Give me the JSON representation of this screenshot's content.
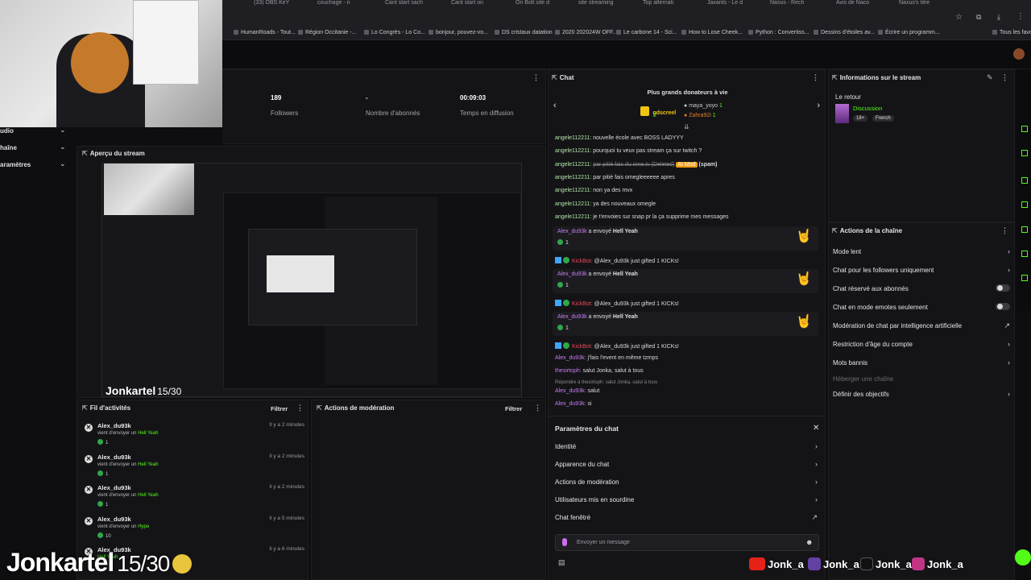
{
  "browser": {
    "tabs": [
      "(33) OBS KeY",
      "couchage - n",
      "Cant start sach",
      "Cant start on",
      "On Bolt site d",
      "site streaming",
      "Top alternati",
      "Jaxants - Le d",
      "Nasus - Rech",
      "Avis de Naco",
      "Naxus's titre"
    ],
    "bookmarks": [
      "HumanRoads - Tout...",
      "Région Occitanie -...",
      "Lo Congrès - Lo Co...",
      "bonjour, pouvez-vo...",
      "DS cristaux datation",
      "2020 202024W OFF...",
      "Le carbone 14 - Sci...",
      "How to Lose Cheek...",
      "Python : Convertiss...",
      "Dessins d'étoiles av...",
      "Écrire un programm...",
      "Tous les favoris"
    ]
  },
  "left_menu": {
    "items": [
      "udio",
      "haîne",
      "aramètres"
    ]
  },
  "stats": [
    {
      "value": "189",
      "label": "Followers"
    },
    {
      "value": "-",
      "label": "Nombre d'abonnés"
    },
    {
      "value": "00:09:03",
      "label": "Temps en diffusion"
    }
  ],
  "preview": {
    "title": "Aperçu du stream",
    "overlay_name": "Jonkartel",
    "overlay_count": "15/30"
  },
  "activity": {
    "title": "Fil d'activités",
    "filter_label": "Filtrer",
    "items": [
      {
        "name": "Alex_du93k",
        "action": "vient d'envoyer un",
        "gift": "Hell Yeah",
        "time": "Il y a 2 minutes",
        "count": "1"
      },
      {
        "name": "Alex_du93k",
        "action": "vient d'envoyer un",
        "gift": "Hell Yeah",
        "time": "Il y a 2 minutes",
        "count": "1"
      },
      {
        "name": "Alex_du93k",
        "action": "vient d'envoyer un",
        "gift": "Hell Yeah",
        "time": "Il y a 2 minutes",
        "count": "1"
      },
      {
        "name": "Alex_du93k",
        "action": "vient d'envoyer un",
        "gift": "Hype",
        "time": "Il y a 5 minutes",
        "count": "10"
      },
      {
        "name": "Alex_du93k",
        "action": "",
        "gift": "Hell Yeah",
        "time": "Il y a 6 minutes",
        "count": ""
      }
    ]
  },
  "moderation": {
    "title": "Actions de modération",
    "filter_label": "Filtrer"
  },
  "chat": {
    "title": "Chat",
    "donors_title": "Plus grands donateurs à vie",
    "donors": [
      {
        "name": "gdscreel",
        "amount": "2"
      },
      {
        "name": "maya_yoyo",
        "amount": "1"
      },
      {
        "name": "Zahra92i",
        "amount": "1"
      }
    ],
    "messages": [
      {
        "user": "angele112211:",
        "text": "nouvelle école avec BOSS LADYYY"
      },
      {
        "user": "angele112211:",
        "text": "pourquoi tu veux pas stream ça sur twitch ?"
      },
      {
        "user": "angele112211:",
        "text": "par pitié fais du ome.tv (Deleted)",
        "tag": "AI Mod",
        "suffix": "(spam)"
      },
      {
        "user": "angele112211:",
        "text": "par pitié fais omegleeeeee apres"
      },
      {
        "user": "angele112211:",
        "text": "non ya des mvx"
      },
      {
        "user": "angele112211:",
        "text": "ya des nouveaux omegle"
      },
      {
        "user": "angele112211:",
        "text": "je t'envoies sur snap pr la ça supprime mes messages"
      }
    ],
    "gifts": [
      {
        "user": "Alex_du93k",
        "text": "a envoyé",
        "gift": "Hell Yeah",
        "count": "1"
      },
      {
        "user": "Alex_du93k",
        "text": "a envoyé",
        "gift": "Hell Yeah",
        "count": "1"
      },
      {
        "user": "Alex_du93k",
        "text": "a envoyé",
        "gift": "Hell Yeah",
        "count": "1"
      }
    ],
    "kickbot": [
      {
        "bot": "KickBot:",
        "text": "@Alex_du93k just gifted 1 KICKs!"
      },
      {
        "bot": "KickBot:",
        "text": "@Alex_du93k just gifted 1 KICKs!"
      },
      {
        "bot": "KickBot:",
        "text": "@Alex_du93k just gifted 1 KICKs!"
      }
    ],
    "tail": [
      {
        "user": "Alex_du93k:",
        "text": "j'fais l'event en même tzmps"
      },
      {
        "user": "thesirtoph:",
        "text": "salut Jonka, salut à tous"
      },
      {
        "reply": "Répondre à thesirtoph: salut Jonka, salut à tous"
      },
      {
        "user": "Alex_du93k:",
        "text": "salut"
      },
      {
        "user": "Alex_du93k:",
        "text": "si"
      }
    ],
    "settings_title": "Paramètres du chat",
    "settings": [
      "Identité",
      "Apparence du chat",
      "Actions de modération",
      "Utilisateurs mis en sourdine",
      "Chat fenêtré"
    ],
    "input_placeholder": "Envoyer un message"
  },
  "stream_info": {
    "title": "Informations sur le stream",
    "stream_title": "Le retour",
    "category": "Discussion",
    "tags": [
      "18+",
      "French"
    ]
  },
  "channel_actions": {
    "title": "Actions de la chaîne",
    "items": [
      {
        "label": "Mode lent",
        "control": "arrow"
      },
      {
        "label": "Chat pour les followers uniquement",
        "control": "arrow"
      },
      {
        "label": "Chat réservé aux abonnés",
        "control": "toggle"
      },
      {
        "label": "Chat en mode emotes seulement",
        "control": "toggle"
      },
      {
        "label": "Modération de chat par intelligence artificielle",
        "control": "external"
      },
      {
        "label": "Restriction d'âge du compte",
        "control": "arrow"
      },
      {
        "label": "Mots bannis",
        "control": "arrow"
      },
      {
        "label": "Héberger une chaîne",
        "control": "none"
      },
      {
        "label": "Définir des objectifs",
        "control": "arrow"
      }
    ]
  },
  "overlay": {
    "name": "Jonkartel",
    "count": "15/30",
    "socials": [
      "Jonk_a",
      "Jonk_a",
      "Jonk_a",
      "Jonk_a"
    ]
  },
  "colors": {
    "accent": "#53fc18",
    "panel": "#141417",
    "bg": "#0e0e10",
    "kickbot": "#e9485a",
    "ai_mod": "#f39c12"
  }
}
